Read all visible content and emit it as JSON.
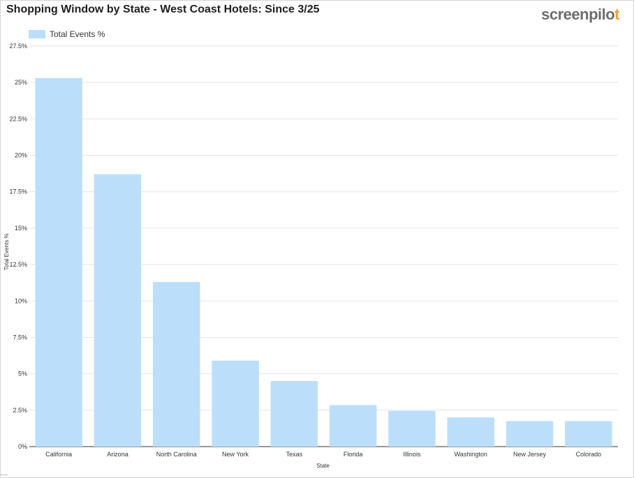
{
  "page": {
    "title": "Shopping Window by State - West Coast Hotels: Since 3/25",
    "logo_main": "screenpilo",
    "logo_accent": "t"
  },
  "chart_data": {
    "type": "bar",
    "title": "Shopping Window by State - West Coast Hotels: Since 3/25",
    "xlabel": "State",
    "ylabel": "Total Events %",
    "categories": [
      "California",
      "Arizona",
      "North Carolina",
      "New York",
      "Texas",
      "Florida",
      "Illinois",
      "Washington",
      "New Jersey",
      "Colorado"
    ],
    "series": [
      {
        "name": "Total Events %",
        "values": [
          25.3,
          18.7,
          11.3,
          5.9,
          4.5,
          2.85,
          2.45,
          2.0,
          1.75,
          1.75
        ],
        "color": "#bbdefb"
      }
    ],
    "ylim": [
      0,
      27.5
    ],
    "yticks": [
      "0%",
      "2.5%",
      "5%",
      "7.5%",
      "10%",
      "12.5%",
      "15%",
      "17.5%",
      "20%",
      "22.5%",
      "25%",
      "27.5%"
    ],
    "grid": true,
    "legend_position": "top-left"
  }
}
